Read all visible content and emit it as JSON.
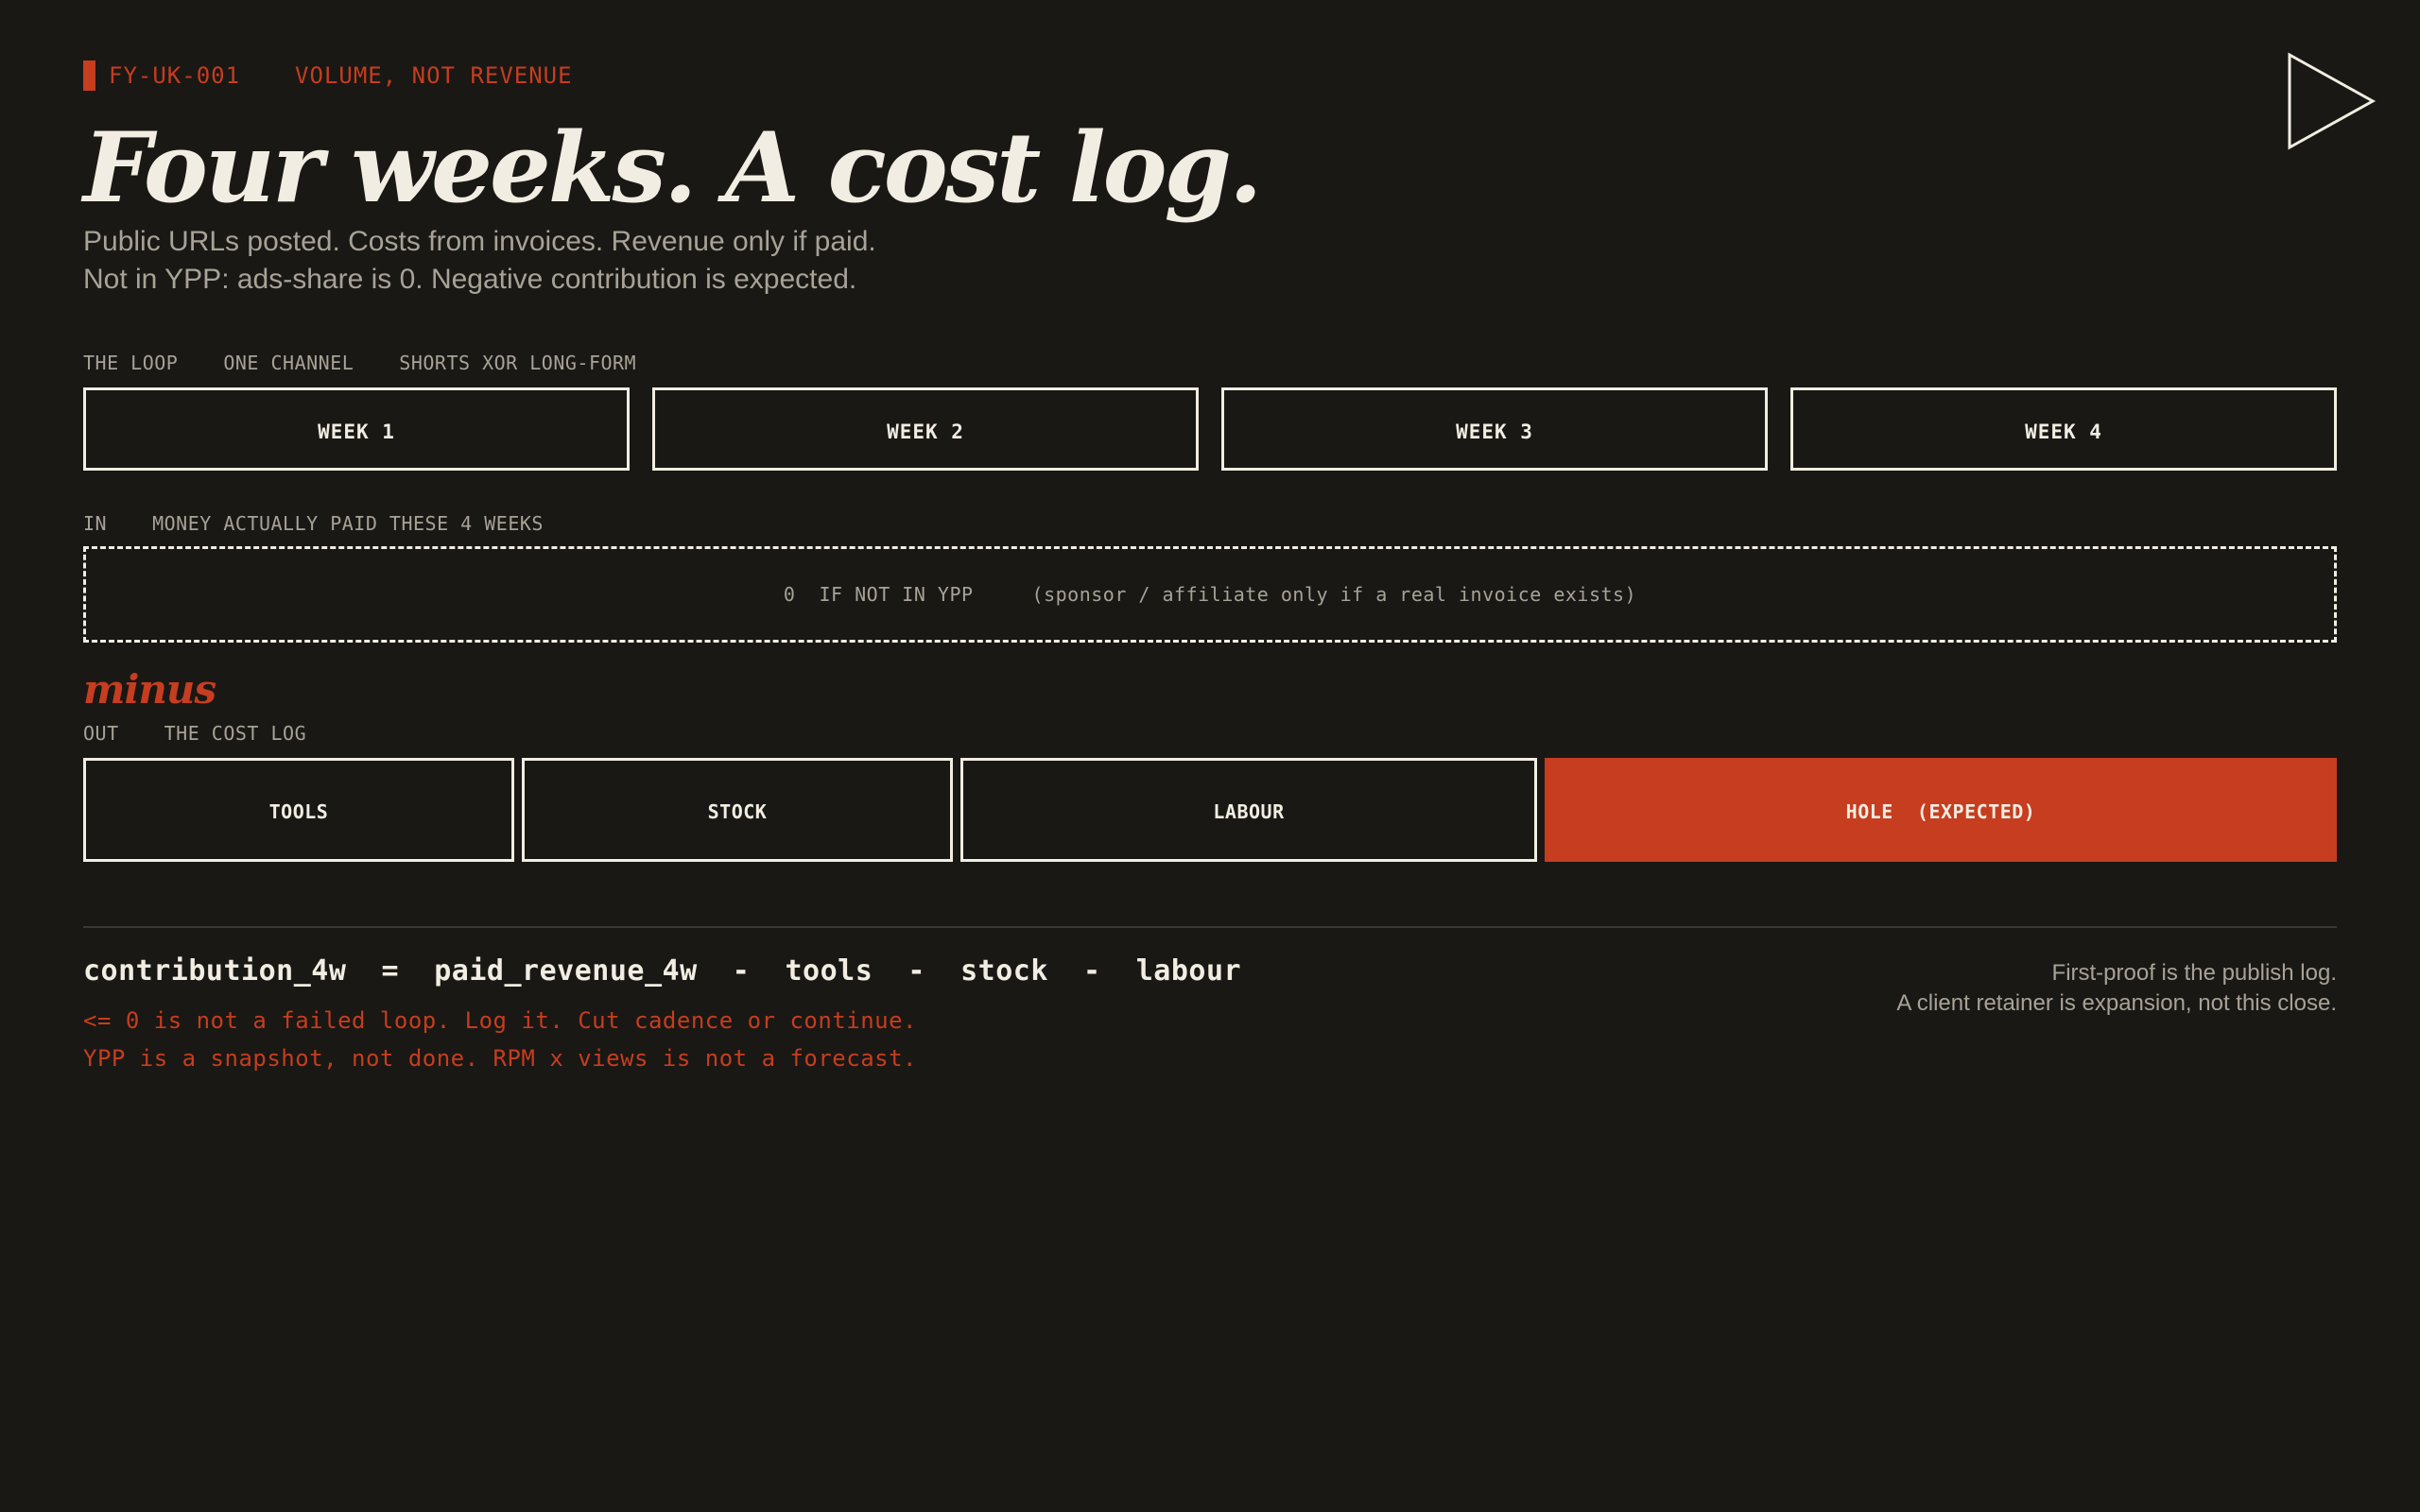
{
  "header": {
    "code": "FY-UK-001",
    "tag": "VOLUME, NOT REVENUE",
    "title": "Four weeks. A cost log.",
    "subtitle_lines": [
      "Public URLs posted. Costs from invoices. Revenue only if paid.",
      "Not in YPP: ads-share is 0. Negative contribution is expected."
    ]
  },
  "loop": {
    "labels": [
      "THE LOOP",
      "ONE CHANNEL",
      "SHORTS XOR LONG-FORM"
    ],
    "weeks": [
      "WEEK 1",
      "WEEK 2",
      "WEEK 3",
      "WEEK 4"
    ]
  },
  "in_section": {
    "labels": [
      "IN",
      "MONEY ACTUALLY PAID THESE 4 WEEKS"
    ],
    "value": "0  IF NOT IN YPP",
    "note": "(sponsor / affiliate only if a real invoice exists)"
  },
  "minus": "minus",
  "out_section": {
    "labels": [
      "OUT",
      "THE COST LOG"
    ],
    "items": [
      "TOOLS",
      "STOCK",
      "LABOUR"
    ],
    "hole": "HOLE  (EXPECTED)"
  },
  "formula": {
    "text": "contribution_4w  =  paid_revenue_4w  -  tools  -  stock  -  labour",
    "notes": [
      "<= 0 is not a failed loop. Log it. Cut cadence or continue.",
      "YPP is a snapshot, not done. RPM x views is not a forecast."
    ]
  },
  "aside": [
    "First-proof is the publish log.",
    "A client retainer is expansion, not this close."
  ],
  "colors": {
    "background": "#191815",
    "accent": "#c63d1f",
    "text": "#f2ede2",
    "muted": "#a8a297"
  },
  "icons": {
    "play": "play-outline-icon"
  }
}
